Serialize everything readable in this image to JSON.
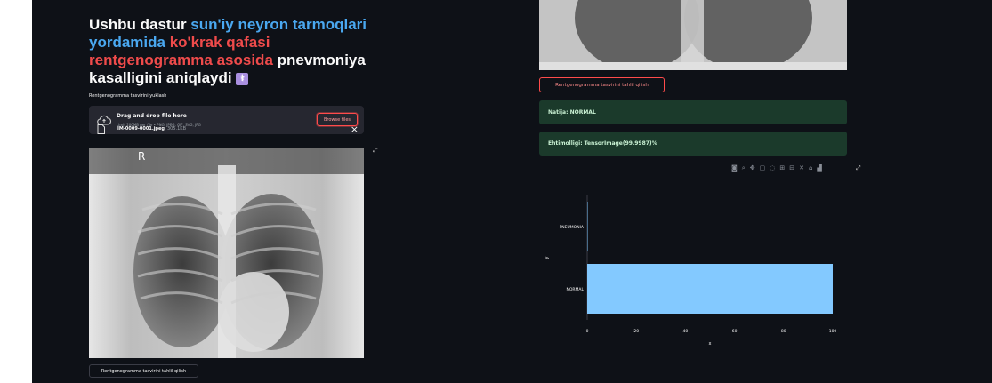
{
  "title": {
    "part1": "Ushbu dastur ",
    "part2": "sun'iy neyron tarmoqlari yordamida",
    "part3": " ko'krak qafasi rentgenogramma asosida",
    "part4": " pnevmoniya kasalligini aniqlaydi ",
    "emoji_icon": "caduceus-icon"
  },
  "uploader": {
    "label": "Rentgenogramma tasvirini yuklash",
    "drag_text": "Drag and drop file here",
    "limit_text": "Limit 200MB per file • PNG, JPEG, GIF, SVG, JPG",
    "browse_label": "Browse files"
  },
  "file": {
    "name": "IM-0009-0001.jpeg",
    "size": "305.1KB",
    "close_glyph": "×"
  },
  "xray_marker": "R",
  "left_button": "Rentgenogramma tasvirini tahlil qilish",
  "right_button": "Rentgenogramma tasvirini tahlil qilish",
  "result": "Natija: NORMAL",
  "probability": "Ehtimolligi: TensorImage(99.9987)%",
  "toolbar_icons": [
    "camera-icon",
    "zoom-icon",
    "pan-icon",
    "box-select-icon",
    "lasso-icon",
    "zoom-in-icon",
    "zoom-out-icon",
    "autoscale-icon",
    "home-icon",
    "plotly-logo-icon"
  ],
  "chart_data": {
    "type": "bar",
    "orientation": "horizontal",
    "categories": [
      "NORMAL",
      "PNEUMONIA"
    ],
    "values": [
      99.9987,
      0.0013
    ],
    "xlabel": "x",
    "ylabel": "y",
    "xticks": [
      "0",
      "20",
      "40",
      "60",
      "80",
      "100"
    ],
    "xlim": [
      0,
      100
    ],
    "bar_color": "#83c9ff"
  }
}
